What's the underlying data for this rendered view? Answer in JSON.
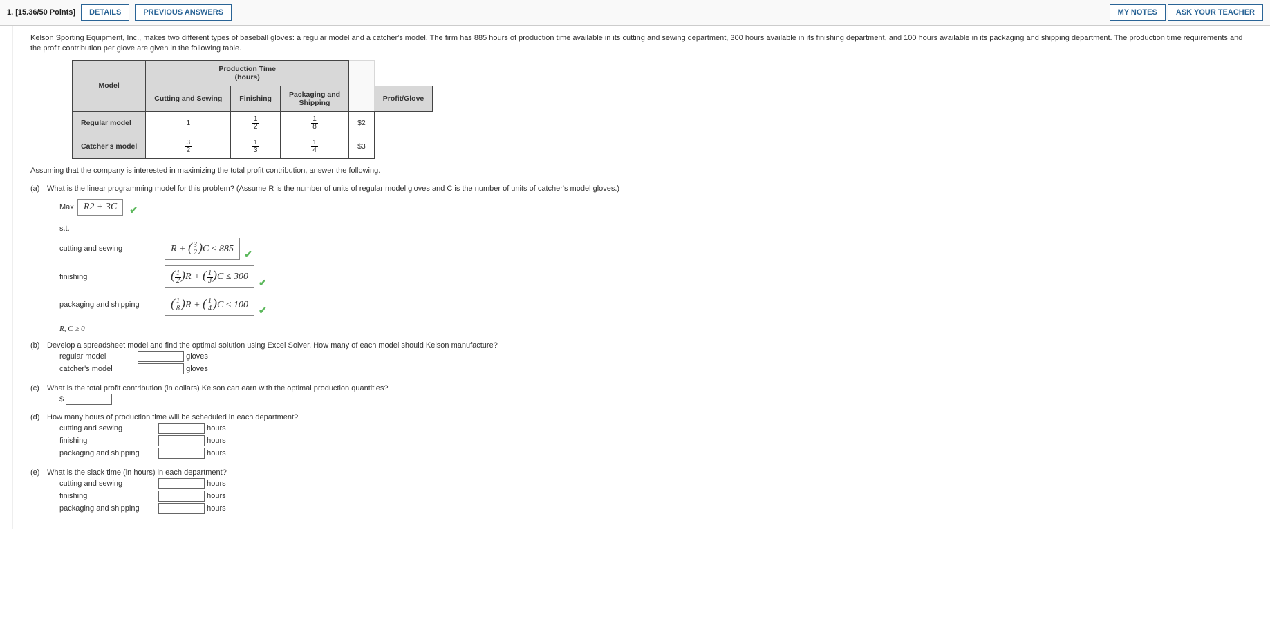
{
  "header": {
    "qnum": "1.",
    "points": "[15.36/50 Points]",
    "details_btn": "DETAILS",
    "prev_btn": "PREVIOUS ANSWERS",
    "notes_btn": "MY NOTES",
    "ask_btn": "ASK YOUR TEACHER"
  },
  "problem": {
    "intro": "Kelson Sporting Equipment, Inc., makes two different types of baseball gloves: a regular model and a catcher's model. The firm has 885 hours of production time available in its cutting and sewing department, 300 hours available in its finishing department, and 100 hours available in its packaging and shipping department. The production time requirements and the profit contribution per glove are given in the following table.",
    "table": {
      "model_hdr": "Model",
      "prod_hdr": "Production Time\n(hours)",
      "cols": [
        "Cutting and Sewing",
        "Finishing",
        "Packaging and Shipping",
        "Profit/Glove"
      ],
      "rows": [
        {
          "label": "Regular model",
          "cut": "1",
          "fin_frac": [
            "1",
            "2"
          ],
          "pack_frac": [
            "1",
            "8"
          ],
          "profit": "$2"
        },
        {
          "label": "Catcher's model",
          "cut_frac": [
            "3",
            "2"
          ],
          "fin_frac": [
            "1",
            "3"
          ],
          "pack_frac": [
            "1",
            "4"
          ],
          "profit": "$3"
        }
      ]
    },
    "assume": "Assuming that the company is interested in maximizing the total profit contribution, answer the following."
  },
  "parts": {
    "a": {
      "q": "What is the linear programming model for this problem? (Assume R is the number of units of regular model gloves and C is the number of units of catcher's model gloves.)",
      "maxlbl": "Max",
      "maxval": "R2 + 3C",
      "st": "s.t.",
      "c1_lbl": "cutting and sewing",
      "c1_val": "R + (3/2)C ≤ 885",
      "c2_lbl": "finishing",
      "c2_val": "(1/2)R + (1/3)C ≤ 300",
      "c3_lbl": "packaging and shipping",
      "c3_val": "(1/8)R + (1/4)C ≤ 100",
      "nonneg": "R, C ≥ 0"
    },
    "b": {
      "q": "Develop a spreadsheet model and find the optimal solution using Excel Solver. How many of each model should Kelson manufacture?",
      "r1": "regular model",
      "r1u": "gloves",
      "r2": "catcher's model",
      "r2u": "gloves"
    },
    "c": {
      "q": "What is the total profit contribution (in dollars) Kelson can earn with the optimal production quantities?",
      "prefix": "$"
    },
    "d": {
      "q": "How many hours of production time will be scheduled in each department?",
      "r1": "cutting and sewing",
      "u": "hours",
      "r2": "finishing",
      "r3": "packaging and shipping"
    },
    "e": {
      "q": "What is the slack time (in hours) in each department?",
      "r1": "cutting and sewing",
      "u": "hours",
      "r2": "finishing",
      "r3": "packaging and shipping"
    }
  },
  "chart_data": {
    "type": "table",
    "title": "Production Time (hours) and Profit/Glove",
    "columns": [
      "Model",
      "Cutting and Sewing",
      "Finishing",
      "Packaging and Shipping",
      "Profit/Glove"
    ],
    "rows": [
      [
        "Regular model",
        1,
        0.5,
        0.125,
        2
      ],
      [
        "Catcher's model",
        1.5,
        0.3333,
        0.25,
        3
      ]
    ],
    "resources": {
      "cutting_sewing": 885,
      "finishing": 300,
      "packaging_shipping": 100
    }
  }
}
